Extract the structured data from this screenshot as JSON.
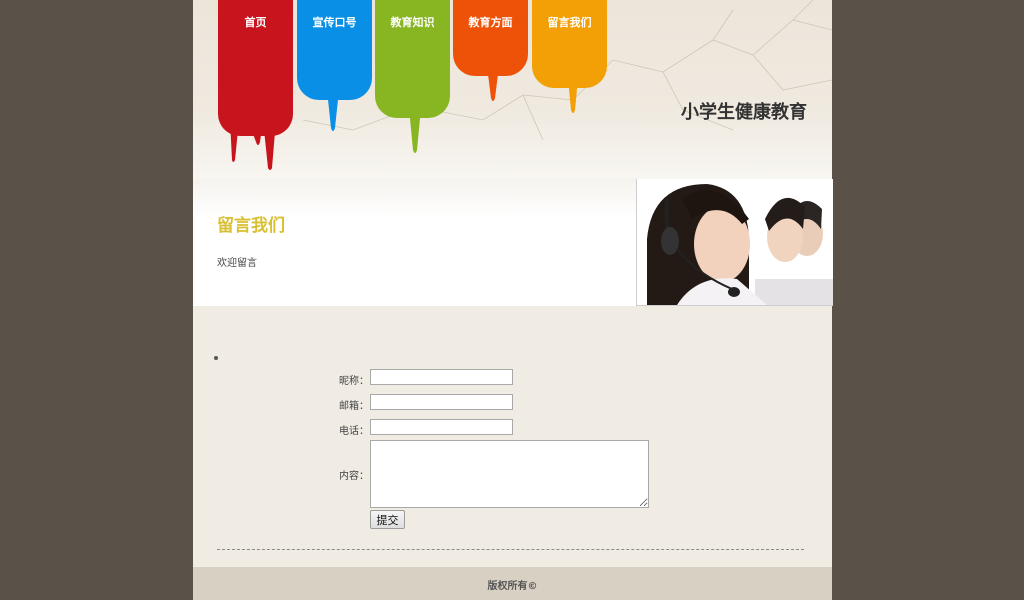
{
  "header": {
    "site_title": "小学生健康教育",
    "nav": [
      {
        "label": "首页",
        "color": "#c8141c"
      },
      {
        "label": "宣传口号",
        "color": "#0a8fe6"
      },
      {
        "label": "教育知识",
        "color": "#88b522"
      },
      {
        "label": "教育方面",
        "color": "#ee5208"
      },
      {
        "label": "留言我们",
        "color": "#f2a006"
      }
    ]
  },
  "banner": {
    "heading": "留言我们",
    "subtext": "欢迎留言"
  },
  "form": {
    "nickname_label": "昵称：",
    "nickname_value": "",
    "email_label": "邮箱：",
    "email_value": "",
    "phone_label": "电话：",
    "phone_value": "",
    "content_label": "内容：",
    "content_value": "",
    "submit_label": "提交"
  },
  "footer": {
    "copyright": "版权所有©"
  }
}
